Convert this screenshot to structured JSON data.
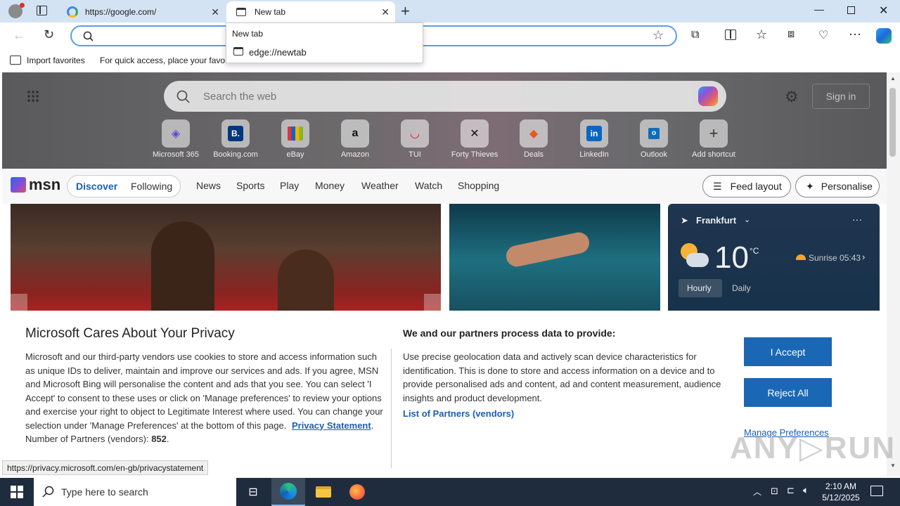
{
  "tabs": [
    {
      "title": "https://google.com/",
      "active": false
    },
    {
      "title": "New tab",
      "active": true
    }
  ],
  "address": {
    "value": "",
    "dropdown": {
      "header": "New tab",
      "item": "edge://newtab"
    }
  },
  "favbar": {
    "import": "Import favorites",
    "hint": "For quick access, place your favori"
  },
  "newtab": {
    "search_placeholder": "Search the web",
    "signin": "Sign in",
    "shortcuts": [
      "Microsoft 365",
      "Booking.com",
      "eBay",
      "Amazon",
      "TUI",
      "Forty Thieves",
      "Deals",
      "LinkedIn",
      "Outlook",
      "Add shortcut"
    ]
  },
  "msn": {
    "logo": "msn",
    "nav": [
      "Discover",
      "Following",
      "News",
      "Sports",
      "Play",
      "Money",
      "Weather",
      "Watch",
      "Shopping"
    ],
    "feed_layout": "Feed layout",
    "personalise": "Personalise"
  },
  "weather": {
    "city": "Frankfurt",
    "temp": "10",
    "unit": "°C",
    "sunrise": "Sunrise 05:43",
    "tabs": [
      "Hourly",
      "Daily"
    ]
  },
  "privacy": {
    "title": "Microsoft Cares About Your Privacy",
    "body": "Microsoft and our third-party vendors use cookies to store and access information such as unique IDs to deliver, maintain and improve our services and ads. If you agree, MSN and Microsoft Bing will personalise the content and ads that you see. You can select 'I Accept' to consent to these uses or click on 'Manage preferences' to review your options and exercise your right to object to Legitimate Interest where used.  You can change your selection under 'Manage Preferences' at the bottom of this page.",
    "privacy_link": "Privacy Statement",
    "partners_label": "Number of Partners (vendors):",
    "partners_count": "852",
    "right_title": "We and our partners process data to provide:",
    "right_body": "Use precise geolocation data and actively scan device characteristics for identification. This is done to store and access information on a device and to provide personalised ads and content, ad and content measurement, audience insights and product development.",
    "partners_link": "List of Partners (vendors)",
    "accept": "I Accept",
    "reject": "Reject All",
    "manage": "Manage Preferences"
  },
  "status_url": "https://privacy.microsoft.com/en-gb/privacystatement",
  "taskbar": {
    "search_placeholder": "Type here to search",
    "time": "2:10 AM",
    "date": "5/12/2025"
  },
  "colors": {
    "accent": "#1a67b5",
    "tabbar": "#d3e3f4",
    "taskbar": "#1f2c3e"
  }
}
